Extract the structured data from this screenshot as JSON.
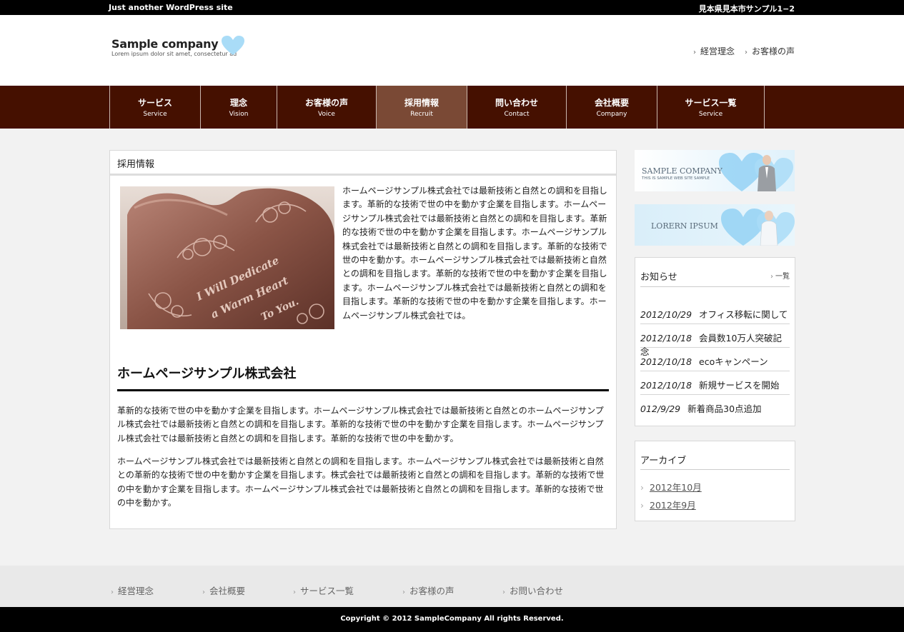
{
  "topbar": {
    "tagline": "Just another WordPress site",
    "address": "見本県見本市サンプル1−2"
  },
  "header": {
    "logo_name": "Sample company",
    "logo_sub": "Lorem ipsum dolor sit amet, consectetur ad",
    "links": [
      "経営理念",
      "お客様の声"
    ]
  },
  "nav": {
    "items": [
      {
        "ja": "サービス",
        "en": "Service"
      },
      {
        "ja": "理念",
        "en": "Vision"
      },
      {
        "ja": "お客様の声",
        "en": "Voice"
      },
      {
        "ja": "採用情報",
        "en": "Recruit"
      },
      {
        "ja": "問い合わせ",
        "en": "Contact"
      },
      {
        "ja": "会社概要",
        "en": "Company"
      },
      {
        "ja": "サービス一覧",
        "en": "Service"
      }
    ]
  },
  "main": {
    "page_title": "採用情報",
    "image_text": [
      "I Will Dedicate",
      "a Warm Heart",
      "To You."
    ],
    "intro_text": "ホームページサンプル株式会社では最新技術と自然との調和を目指します。革新的な技術で世の中を動かす企業を目指します。ホームページサンプル株式会社では最新技術と自然との調和を目指します。革新的な技術で世の中を動かす企業を目指します。ホームページサンプル株式会社では最新技術と自然との調和を目指します。革新的な技術で世の中を動かす。ホームページサンプル株式会社では最新技術と自然との調和を目指します。革新的な技術で世の中を動かす企業を目指します。ホームページサンプル株式会社では最新技術と自然との調和を目指します。革新的な技術で世の中を動かす企業を目指します。ホームページサンプル株式会社では。",
    "company_heading": "ホームページサンプル株式会社",
    "para1": "革新的な技術で世の中を動かす企業を目指します。ホームページサンプル株式会社では最新技術と自然とのホームページサンプル株式会社では最新技術と自然との調和を目指します。革新的な技術で世の中を動かす企業を目指します。ホームページサンプル株式会社では最新技術と自然との調和を目指します。革新的な技術で世の中を動かす。",
    "para2": "ホームページサンプル株式会社では最新技術と自然との調和を目指します。ホームページサンプル株式会社では最新技術と自然との革新的な技術で世の中を動かす企業を目指します。株式会社では最新技術と自然との調和を目指します。革新的な技術で世の中を動かす企業を目指します。ホームページサンプル株式会社では最新技術と自然との調和を目指します。革新的な技術で世の中を動かす。"
  },
  "sidebar": {
    "banner1_title": "SAMPLE COMPANY",
    "banner1_sub": "THIS IS SAMPLE WEB SITE SAMPLE",
    "banner2_title": "LORERN IPSUM",
    "news_title": "お知らせ",
    "news_more": "一覧",
    "news": [
      {
        "date": "2012/10/29",
        "title": "オフィス移転に関して"
      },
      {
        "date": "2012/10/18",
        "title": "会員数10万人突破記念"
      },
      {
        "date": "2012/10/18",
        "title": "ecoキャンペーン"
      },
      {
        "date": "2012/10/18",
        "title": "新規サービスを開始"
      },
      {
        "date": "012/9/29",
        "title": "新着商品30点追加"
      }
    ],
    "archive_title": "アーカイブ",
    "archive": [
      "2012年10月",
      "2012年9月"
    ]
  },
  "footer": {
    "links": [
      "経営理念",
      "会社概要",
      "サービス一覧",
      "お客様の声",
      "お問い合わせ"
    ],
    "copyright": "Copyright © 2012 SampleCompany All rights Reserved."
  },
  "colors": {
    "nav_bg": "#451000",
    "nav_active": "#7a4935",
    "topbar_bg": "#000000",
    "heart_blue": "#8fd0f4"
  }
}
